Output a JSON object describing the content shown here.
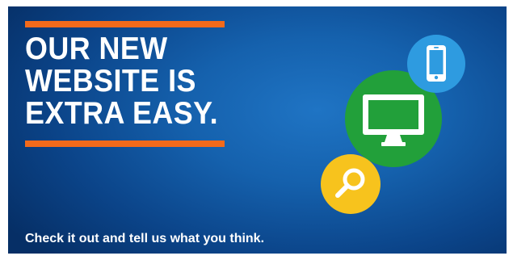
{
  "banner": {
    "headline_lines": [
      "OUR NEW",
      "WEBSITE IS",
      "EXTRA EASY."
    ],
    "tagline": "Check it out and tell us what you think.",
    "icons": {
      "phone": "smartphone-icon",
      "monitor": "desktop-monitor-icon",
      "search": "magnifying-glass-icon"
    },
    "colors": {
      "background": "#1561ad",
      "accent_bar": "#f26a1b",
      "monitor_circle": "#22a03a",
      "phone_circle": "#2e9be0",
      "search_circle": "#f7c31d",
      "text": "#ffffff"
    }
  }
}
